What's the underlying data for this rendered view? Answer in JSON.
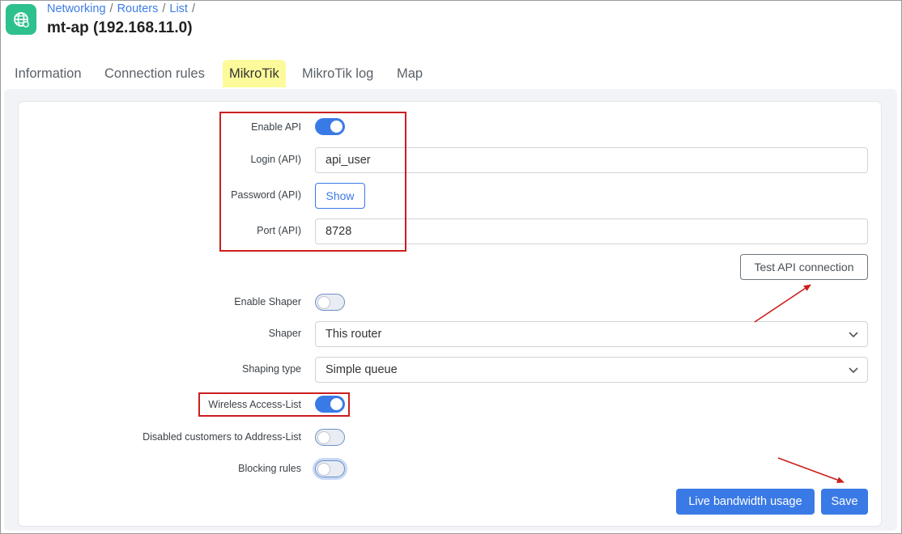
{
  "breadcrumb": {
    "items": [
      "Networking",
      "Routers",
      "List"
    ],
    "separator": "/"
  },
  "page_title": "mt-ap (192.168.11.0)",
  "tabs": [
    {
      "label": "Information"
    },
    {
      "label": "Connection rules"
    },
    {
      "label": "MikroTik",
      "active": true
    },
    {
      "label": "MikroTik log"
    },
    {
      "label": "Map"
    }
  ],
  "form": {
    "enable_api": {
      "label": "Enable API",
      "value": true
    },
    "login_api": {
      "label": "Login (API)",
      "value": "api_user"
    },
    "password_api": {
      "label": "Password (API)",
      "button": "Show"
    },
    "port_api": {
      "label": "Port (API)",
      "value": "8728"
    },
    "test_api_button": "Test API connection",
    "enable_shaper": {
      "label": "Enable Shaper",
      "value": false
    },
    "shaper": {
      "label": "Shaper",
      "value": "This router"
    },
    "shaping_type": {
      "label": "Shaping type",
      "value": "Simple queue"
    },
    "wireless_access_list": {
      "label": "Wireless Access-List",
      "value": true
    },
    "disabled_customers": {
      "label": "Disabled customers to Address-List",
      "value": false
    },
    "blocking_rules": {
      "label": "Blocking rules",
      "value": false
    }
  },
  "actions": {
    "live_bandwidth": "Live bandwidth usage",
    "save": "Save"
  },
  "colors": {
    "accent": "#3a7ae6",
    "app_icon": "#2ec08d",
    "active_tab": "#fcfa9a",
    "annotation": "#cc1f1f"
  },
  "icons": {
    "app": "globe-icon",
    "select": "chevron-down-icon"
  }
}
